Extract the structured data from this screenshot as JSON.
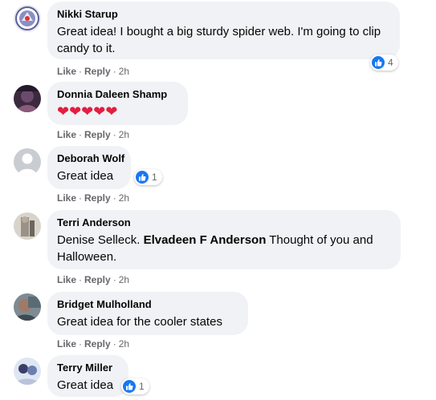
{
  "comments": [
    {
      "author": "Nikki Starup",
      "text": "Great idea! I bought a big sturdy spider web. I'm going to clip candy to it.",
      "like": "Like",
      "reply": "Reply",
      "time": "2h",
      "reactions": "4"
    },
    {
      "author": "Donnia Daleen Shamp",
      "hearts": "❤❤❤❤❤",
      "like": "Like",
      "reply": "Reply",
      "time": "2h"
    },
    {
      "author": "Deborah Wolf",
      "text": "Great idea",
      "like": "Like",
      "reply": "Reply",
      "time": "2h",
      "reactions": "1"
    },
    {
      "author": "Terri Anderson",
      "text_pre": "Denise Selleck. ",
      "mention": "Elvadeen F Anderson",
      "text_post": " Thought of you and Halloween.",
      "like": "Like",
      "reply": "Reply",
      "time": "2h"
    },
    {
      "author": "Bridget Mulholland",
      "text": "Great idea for the cooler states",
      "like": "Like",
      "reply": "Reply",
      "time": "2h"
    },
    {
      "author": "Terry Miller",
      "text": "Great idea",
      "reactions": "1"
    }
  ],
  "separator": "·",
  "colors": {
    "bubble": "#f0f2f5",
    "like_blue": "#1877f2",
    "heart_red": "#e41e3f",
    "meta_gray": "#65676b"
  }
}
